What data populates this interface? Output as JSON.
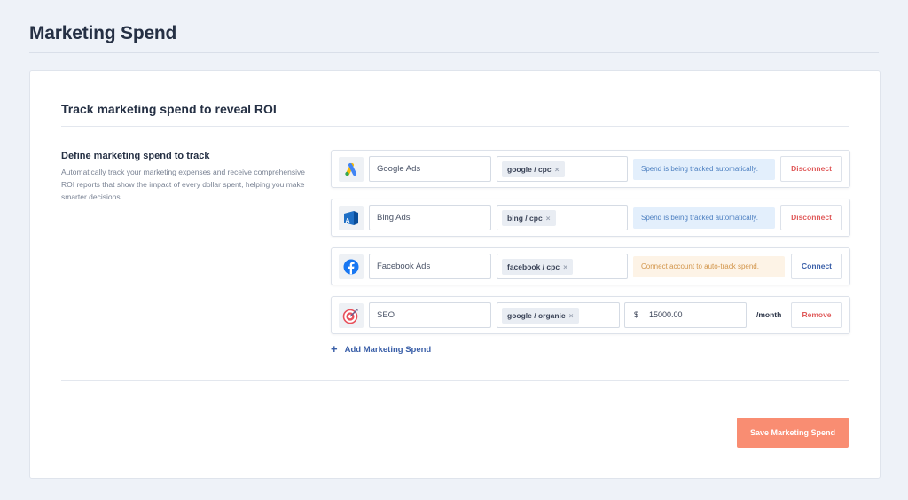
{
  "page": {
    "title": "Marketing Spend"
  },
  "card": {
    "heading": "Track marketing spend to reveal ROI",
    "section_title": "Define marketing spend to track",
    "section_desc": "Automatically track your marketing expenses and receive comprehensive ROI reports that show the impact of every dollar spent, helping you make smarter decisions."
  },
  "rows": [
    {
      "name": "Google Ads",
      "tag": "google / cpc",
      "status": "Spend is being tracked automatically.",
      "action": "Disconnect",
      "icon": "google-ads-icon"
    },
    {
      "name": "Bing Ads",
      "tag": "bing / cpc",
      "status": "Spend is being tracked automatically.",
      "action": "Disconnect",
      "icon": "bing-ads-icon"
    },
    {
      "name": "Facebook Ads",
      "tag": "facebook / cpc",
      "status": "Connect account to auto-track spend.",
      "action": "Connect",
      "icon": "facebook-icon"
    },
    {
      "name": "SEO",
      "tag": "google / organic",
      "currency": "$",
      "amount": "15000.00",
      "period": "/month",
      "action": "Remove",
      "icon": "target-icon"
    }
  ],
  "tag_remove_glyph": "×",
  "add_label": "Add Marketing Spend",
  "add_glyph": "+",
  "save_label": "Save Marketing Spend",
  "colors": {
    "accent": "#f98d72",
    "link": "#3a5fa8",
    "danger": "#e05a5a",
    "info_bg": "#e3effc",
    "warn_bg": "#fdf3e6"
  }
}
